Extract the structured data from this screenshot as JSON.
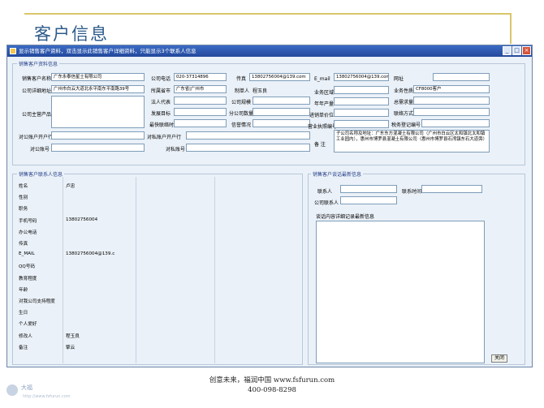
{
  "slide": {
    "title": "客户信息"
  },
  "window": {
    "title": "显示销售客户资料，双击显示此销售客户详细资料，只能显示3个联系人信息",
    "buttons": {
      "minimize": "_",
      "maximize": "□",
      "close": "×"
    }
  },
  "customer": {
    "legend": "销售客户资料信息",
    "name_label": "销售客户名称",
    "name_value": "广东永泰信星土有限公司",
    "phone_label": "公司电话",
    "phone_value": "020-37314896",
    "fax_label": "传真",
    "fax_value": "13802756004@139.com",
    "email_label": "E_mail",
    "email_value": "13802756004@139.com",
    "website_label": "网址",
    "website_value": "",
    "address_label": "公司详细地址",
    "address_value": "广州市白云大道北永平南东平南路39号",
    "province_label": "所属省市",
    "province_value": "广东省|广州市",
    "maker_label": "制单人",
    "maker_value": "程玉良",
    "region_label": "业务区域",
    "region_value": "",
    "nature_label": "业务性质",
    "nature_value": "CF8000客户",
    "legal_label": "法人代表",
    "legal_value": "",
    "scale_label": "公司规模",
    "scale_value": "",
    "annual_label": "年年产量",
    "annual_value": "",
    "demand_label": "总需求量",
    "demand_value": "",
    "products_label": "公司主营产品",
    "products_value": "",
    "dev_label": "发展目标",
    "dev_value": "",
    "branch_label": "分公司数量",
    "branch_value": "",
    "unit_price_label": "进销单价位",
    "unit_price_value": "",
    "contact_way_label": "联络方式",
    "contact_way_value": "",
    "recent_label": "最快联络时间",
    "recent_value": "",
    "credit_label": "信誉情况",
    "credit_value": "",
    "license_label": "营业执照编号",
    "license_value": "",
    "tax_label": "税务登记编号",
    "tax_value": "",
    "bank_label": "对公账户开户行",
    "bank_value": "",
    "bank2_label": "对私账户开户行",
    "bank2_value": "",
    "acct_label": "对公账号",
    "acct_value": "",
    "acct2_label": "对私账号",
    "acct2_value": "",
    "remark_label": "备 注",
    "remark_value": "子公司名称及地址：广东东方混凝土有限公司（广州市白云区太和镇北太和镇工业园内），惠州市博罗县混凝土有限公司（惠州市博罗县石湾镇东石大道旁）"
  },
  "contacts": {
    "legend": "销售客户联系人信息",
    "fields": [
      {
        "label": "姓名",
        "v1": "卢忠",
        "v2": "",
        "v3": ""
      },
      {
        "label": "性别",
        "v1": "",
        "v2": "",
        "v3": ""
      },
      {
        "label": "职务",
        "v1": "",
        "v2": "",
        "v3": ""
      },
      {
        "label": "手机号码",
        "v1": "13802756004",
        "v2": "",
        "v3": ""
      },
      {
        "label": "办公电话",
        "v1": "",
        "v2": "",
        "v3": ""
      },
      {
        "label": "传真",
        "v1": "",
        "v2": "",
        "v3": ""
      },
      {
        "label": "E_MAIL",
        "v1": "13802756004@139.c",
        "v2": "",
        "v3": ""
      },
      {
        "label": "QQ号码",
        "v1": "",
        "v2": "",
        "v3": ""
      },
      {
        "label": "教育程度",
        "v1": "",
        "v2": "",
        "v3": ""
      },
      {
        "label": "年龄",
        "v1": "",
        "v2": "",
        "v3": ""
      },
      {
        "label": "对我公司支持程度",
        "v1": "",
        "v2": "",
        "v3": ""
      },
      {
        "label": "生日",
        "v1": "",
        "v2": "",
        "v3": ""
      },
      {
        "label": "个人爱好",
        "v1": "",
        "v2": "",
        "v3": ""
      },
      {
        "label": "修改人",
        "v1": "程玉良",
        "v2": "",
        "v3": ""
      },
      {
        "label": "备注",
        "v1": "擎云",
        "v2": "",
        "v3": ""
      }
    ]
  },
  "conversation": {
    "legend": "销售客户谈话最新信息",
    "contact_label": "联系人",
    "contact_value": "",
    "time_label": "联系时间",
    "time_value": "",
    "company_contact_label": "公司联系人",
    "company_contact_value": "",
    "content_label": "谈话内容详细记录最新信息",
    "content_value": ""
  },
  "close_button": "关闭",
  "footer": {
    "slogan": "创意未来，福润中国 www.fsfurun.com",
    "phone": "400-098-8298"
  },
  "logo": {
    "text": "大福",
    "url": "http://www.fsfurun.com"
  }
}
